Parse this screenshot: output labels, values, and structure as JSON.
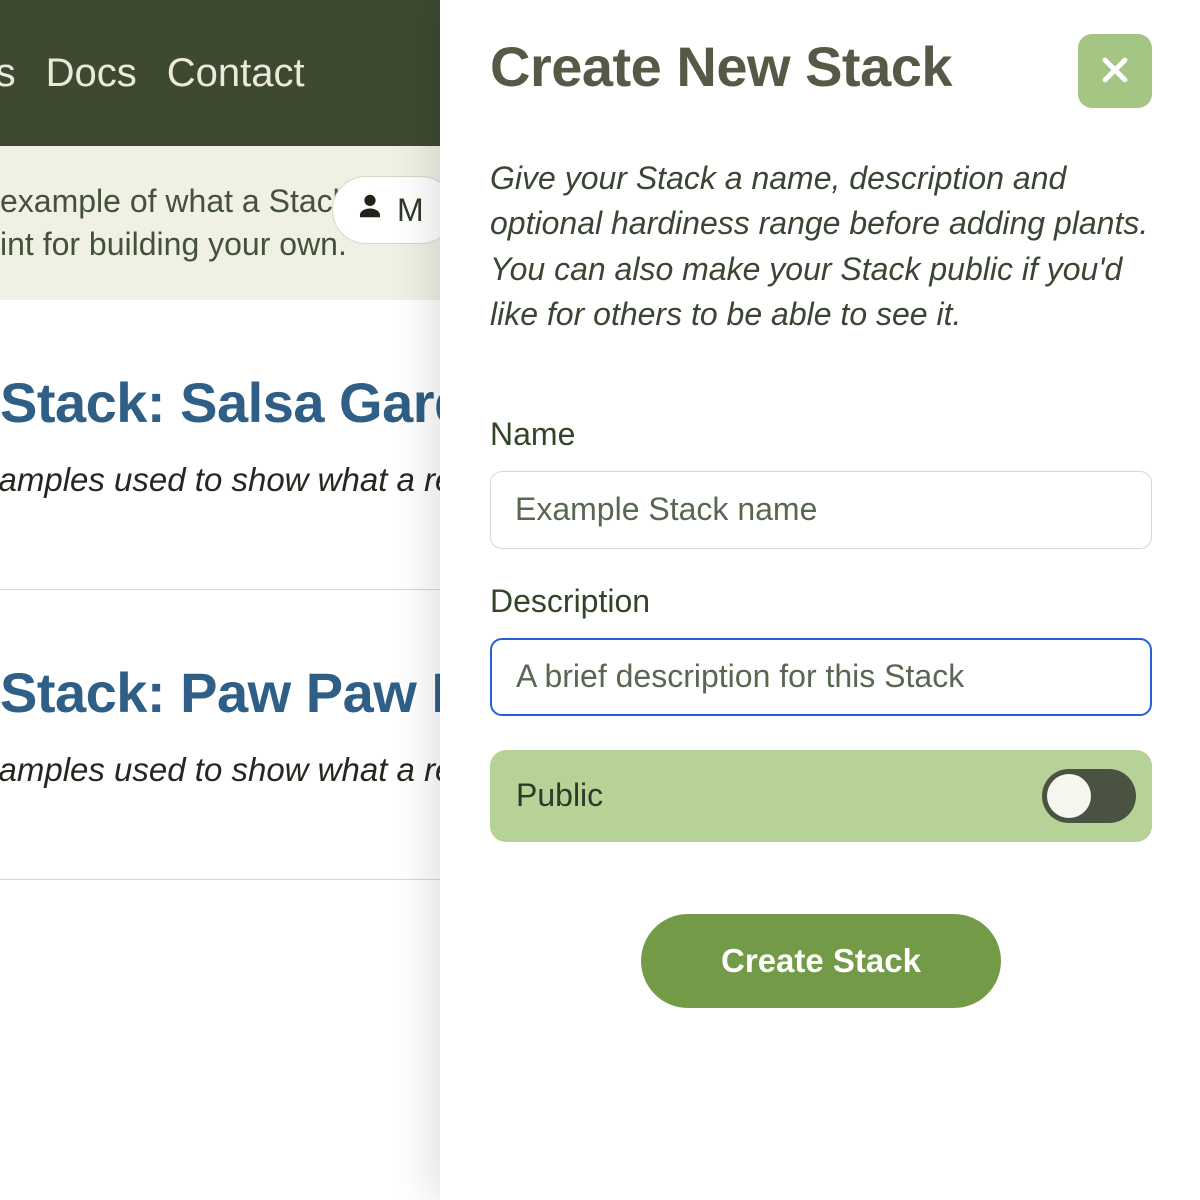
{
  "nav": {
    "items": [
      "ants",
      "Docs",
      "Contact"
    ]
  },
  "intro": {
    "line1": "example of what a Stack",
    "line2": "int for building your own.",
    "pill_label": "M"
  },
  "stacks": [
    {
      "title": "Stack: Salsa Garden",
      "desc": "xamples used to show what a real S"
    },
    {
      "title": "Stack: Paw Paw Pat",
      "desc": "xamples used to show what a real S"
    }
  ],
  "panel": {
    "title": "Create New Stack",
    "intro": "Give your Stack a name, description and optional hardiness range before adding plants. You can also make your Stack public if you'd like for others to be able to see it.",
    "name_label": "Name",
    "name_placeholder": "Example Stack name",
    "desc_label": "Description",
    "desc_placeholder": "A brief description for this Stack",
    "public_label": "Public",
    "public_value": false,
    "submit_label": "Create Stack"
  }
}
